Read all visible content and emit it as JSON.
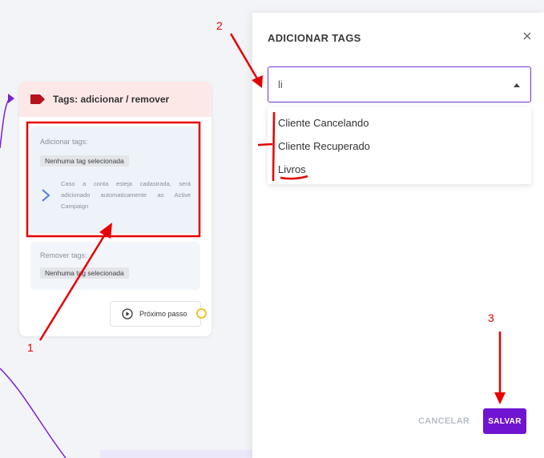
{
  "node": {
    "title": "Tags: adicionar / remover",
    "add_label": "Adicionar tags:",
    "add_chip": "Nenhuma tag selecionada",
    "info_text": "Caso a conta esteja cadastrada, será adicionado automaticamente ao Active Campaign",
    "remove_label": "Remover tags:",
    "remove_chip": "Nenhuma tag selecionada",
    "next_step_label": "Próximo passo"
  },
  "modal": {
    "title": "ADICIONAR TAGS",
    "search_value": "li",
    "options": [
      "Cliente Cancelando",
      "Cliente Recuperado",
      "Livros"
    ],
    "cancel_label": "CANCELAR",
    "save_label": "SALVAR"
  },
  "annotations": {
    "labels": [
      "1",
      "2",
      "3"
    ],
    "color": "#e60000"
  },
  "colors": {
    "accent": "#6f14d0",
    "header_bg": "#fde8e8",
    "tag_icon": "#b5121b",
    "connector": "#f1c232",
    "edge": "#7a1fd4"
  },
  "icons": [
    "tag-icon",
    "chevron-right-icon",
    "play-circle-icon",
    "close-icon",
    "caret-up-icon"
  ]
}
